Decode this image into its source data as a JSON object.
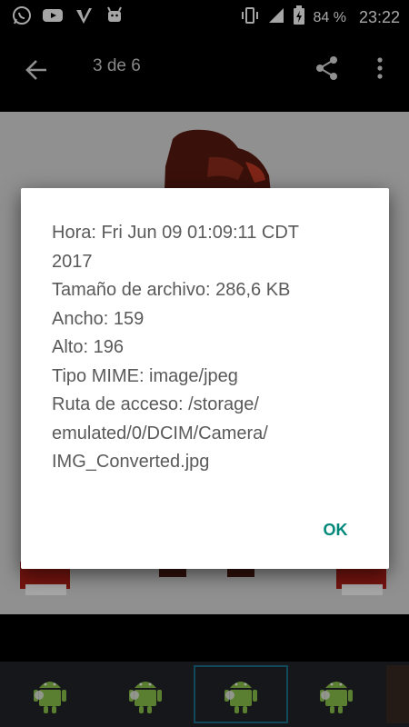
{
  "status_bar": {
    "battery_text": "84 %",
    "time": "23:22",
    "icons": [
      "whatsapp-icon",
      "youtube-icon",
      "check-icon",
      "android-icon",
      "vibrate-icon",
      "signal-icon",
      "battery-icon"
    ]
  },
  "app_bar": {
    "counter": "3 de 6",
    "icons": [
      "back-arrow-icon",
      "share-icon",
      "more-vert-icon"
    ]
  },
  "dialog": {
    "lines": [
      "Hora: Fri Jun 09 01:09:11 CDT",
      "2017",
      "Tamaño de archivo: 286,6 KB",
      "Ancho: 159",
      "Alto: 196",
      "Tipo MIME: image/jpeg",
      "Ruta de acceso: /storage/",
      "emulated/0/DCIM/Camera/",
      "IMG_Converted.jpg"
    ],
    "ok_label": "OK"
  },
  "colors": {
    "accent": "#00897b",
    "dialog_text": "#5a5a5a",
    "filmstrip_bg": "#222428",
    "selected_thumb": "#1a6f8a"
  },
  "filmstrip": {
    "thumbnails": [
      "android-thumbnail-icon",
      "android-thumbnail-icon",
      "android-thumbnail-icon",
      "android-thumbnail-icon"
    ],
    "selected_index": 2
  }
}
